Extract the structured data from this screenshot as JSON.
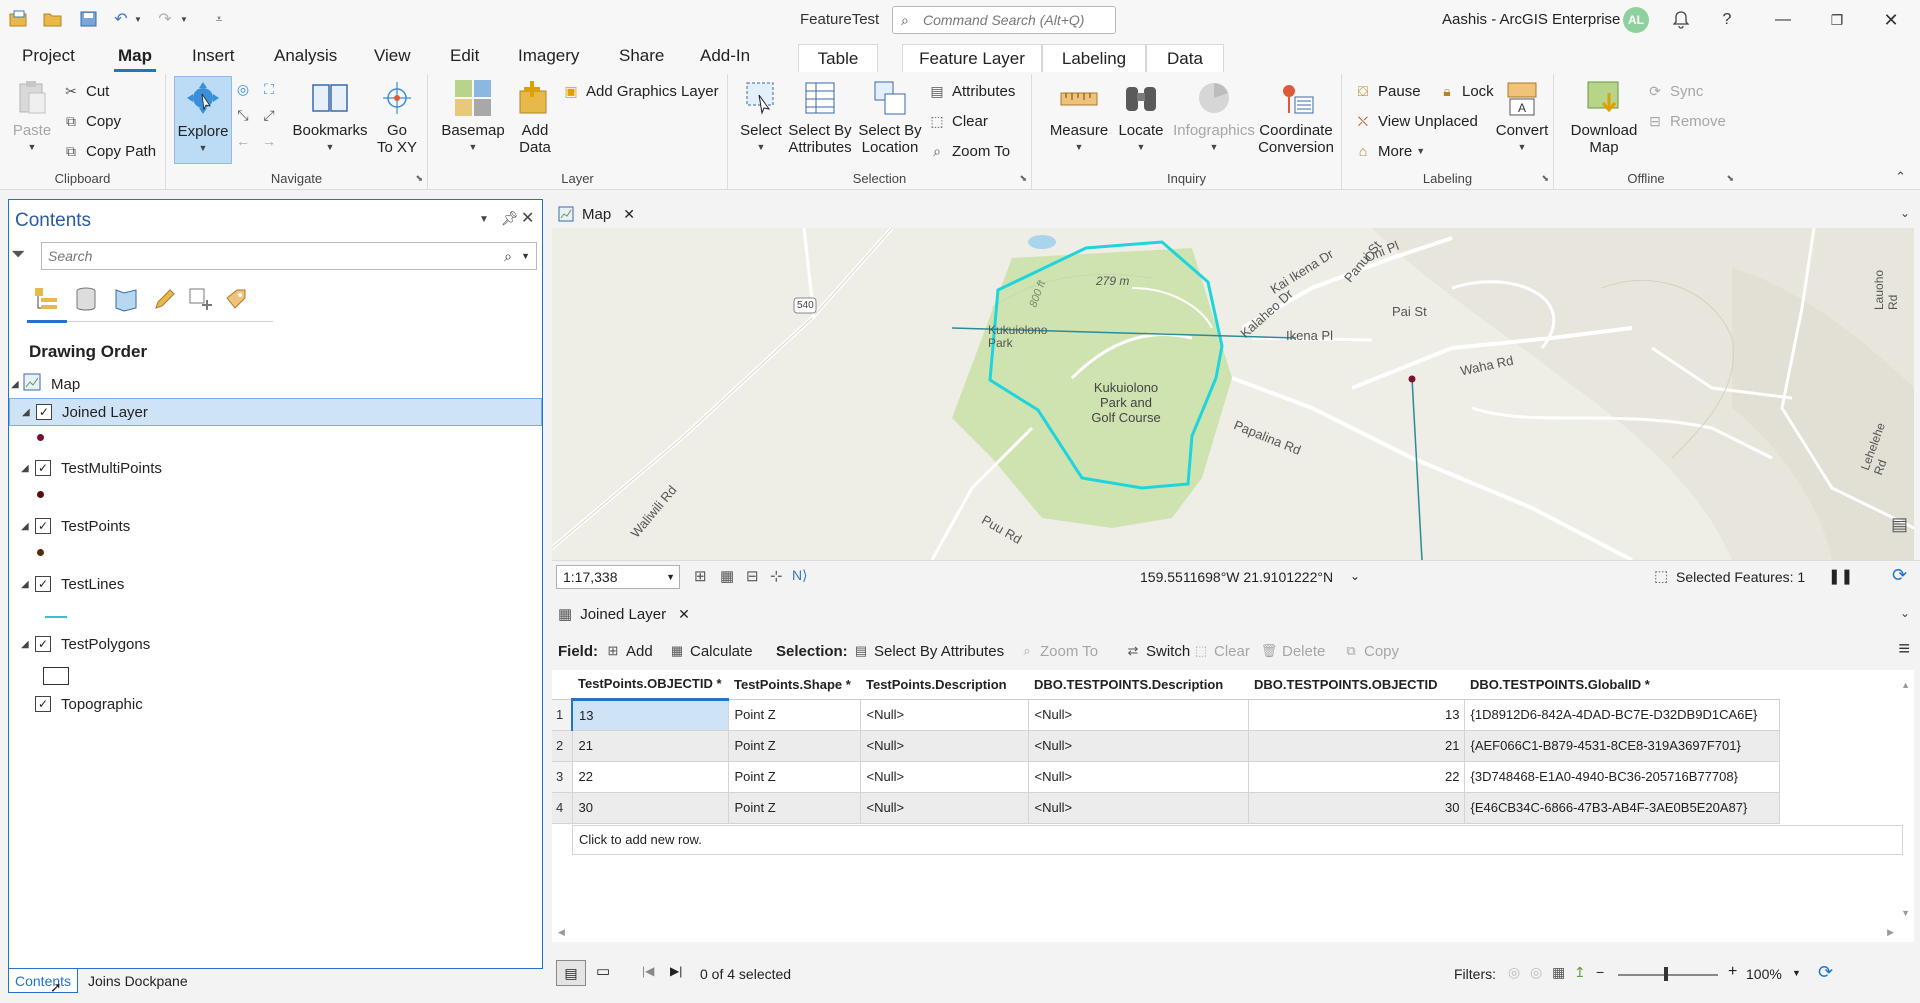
{
  "titlebar": {
    "document_title": "FeatureTest",
    "command_search_placeholder": "Command Search (Alt+Q)",
    "user": "Aashis - ArcGIS Enterprise",
    "avatar_initials": "AL"
  },
  "ribbon_tabs": [
    "Project",
    "Map",
    "Insert",
    "Analysis",
    "View",
    "Edit",
    "Imagery",
    "Share",
    "Add-In",
    "Table",
    "Feature Layer",
    "Labeling",
    "Data"
  ],
  "active_tab": "Map",
  "ribbon": {
    "clipboard": {
      "label": "Clipboard",
      "paste": "Paste",
      "cut": "Cut",
      "copy": "Copy",
      "copy_path": "Copy Path"
    },
    "navigate": {
      "label": "Navigate",
      "explore": "Explore",
      "bookmarks": "Bookmarks",
      "go_to_xy": "Go\nTo XY"
    },
    "layer": {
      "label": "Layer",
      "basemap": "Basemap",
      "add_data": "Add\nData",
      "add_graphics_layer": "Add Graphics Layer"
    },
    "selection": {
      "label": "Selection",
      "select": "Select",
      "select_by_attributes": "Select By\nAttributes",
      "select_by_location": "Select By\nLocation",
      "attributes": "Attributes",
      "clear": "Clear",
      "zoom_to": "Zoom To"
    },
    "inquiry": {
      "label": "Inquiry",
      "measure": "Measure",
      "locate": "Locate",
      "infographics": "Infographics",
      "coordinate_conversion": "Coordinate\nConversion"
    },
    "labeling": {
      "label": "Labeling",
      "pause": "Pause",
      "lock": "Lock",
      "view_unplaced": "View Unplaced",
      "more": "More",
      "convert": "Convert"
    },
    "offline": {
      "label": "Offline",
      "download_map": "Download\nMap",
      "sync": "Sync",
      "remove": "Remove"
    }
  },
  "contents": {
    "title": "Contents",
    "search_placeholder": "Search",
    "drawing_order": "Drawing Order",
    "map_item": "Map",
    "layers": [
      "Joined Layer",
      "TestMultiPoints",
      "TestPoints",
      "TestLines",
      "TestPolygons",
      "Topographic"
    ],
    "bottom_tabs": [
      "Contents",
      "Joins Dockpane"
    ]
  },
  "map": {
    "tab_label": "Map",
    "labels": {
      "route": "540",
      "elevation_1": "279 m",
      "elevation_2": "800 ft",
      "park_small": "Kukuiolono\nPark",
      "park_main": "Kukuiolono\nPark and\nGolf Course",
      "kai_ikena": "Kai Ikena Dr",
      "panui": "Panui St",
      "oni": "Oni Pl",
      "kalaheo": "Kalaheo Dr",
      "ikena": "Ikena Pl",
      "pai": "Pai St",
      "waha": "Waha Rd",
      "papalina": "Papalina Rd",
      "puu": "Puu Rd",
      "waliwili": "Waliwili Rd",
      "lauoho": "Lauoho Rd",
      "lehelehe": "Lehelehe Rd"
    },
    "scale": "1:17,338",
    "coordinates": "159.5511698°W 21.9101222°N",
    "selected_features": "Selected Features: 1"
  },
  "table": {
    "tab_label": "Joined Layer",
    "toolbar": {
      "field_label": "Field:",
      "add": "Add",
      "calculate": "Calculate",
      "selection_label": "Selection:",
      "select_by_attributes": "Select By Attributes",
      "zoom_to": "Zoom To",
      "switch": "Switch",
      "clear": "Clear",
      "delete": "Delete",
      "copy": "Copy"
    },
    "columns": [
      "TestPoints.OBJECTID *",
      "TestPoints.Shape *",
      "TestPoints.Description",
      "DBO.TESTPOINTS.Description",
      "DBO.TESTPOINTS.OBJECTID",
      "DBO.TESTPOINTS.GlobalID *"
    ],
    "rows": [
      [
        "1",
        "13",
        "Point Z",
        "<Null>",
        "<Null>",
        "13",
        "{1D8912D6-842A-4DAD-BC7E-D32DB9D1CA6E}"
      ],
      [
        "2",
        "21",
        "Point Z",
        "<Null>",
        "<Null>",
        "21",
        "{AEF066C1-B879-4531-8CE8-319A3697F701}"
      ],
      [
        "3",
        "22",
        "Point Z",
        "<Null>",
        "<Null>",
        "22",
        "{3D748468-E1A0-4940-BC36-205716B77708}"
      ],
      [
        "4",
        "30",
        "Point Z",
        "<Null>",
        "<Null>",
        "30",
        "{E46CB34C-6866-47B3-AB4F-3AE0B5E20A87}"
      ]
    ],
    "add_row": "Click to add new row.",
    "selection_status": "0 of 4 selected",
    "filters_label": "Filters:",
    "zoom": "100%"
  },
  "colors": {
    "accent": "#2473c8",
    "selection_cyan": "#1fd4dc",
    "park_green": "#cfe3b0"
  }
}
